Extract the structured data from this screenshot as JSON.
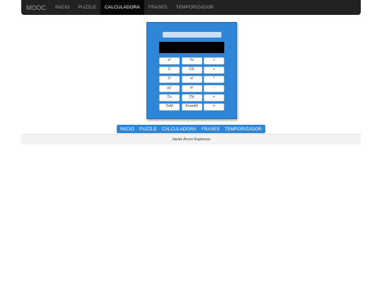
{
  "navbar": {
    "brand": "MOOC",
    "items": [
      {
        "label": "INICIO",
        "active": false
      },
      {
        "label": "PUZZLE",
        "active": false
      },
      {
        "label": "CALCULADORA",
        "active": true
      },
      {
        "label": "FRASES",
        "active": false
      },
      {
        "label": "TEMPORIZADOR",
        "active": false
      }
    ]
  },
  "calculator": {
    "display_value": "",
    "keys": [
      [
        "x²",
        "¹/x",
        "√"
      ],
      [
        "C",
        "CE",
        "+"
      ],
      [
        "2ⁿ",
        "x!",
        "*"
      ],
      [
        "μƒ",
        "xʸ",
        "-"
      ],
      [
        "Σx",
        "∏x",
        "+"
      ],
      [
        "ToM",
        "FromM",
        "="
      ]
    ]
  },
  "bottom_nav": {
    "items": [
      "INICIO",
      "PUZZLE",
      "CALCULADORA",
      "FRASES",
      "TEMPORIZADOR"
    ]
  },
  "footer": {
    "author": "Javier Arcos Espinosa"
  },
  "colors": {
    "navbar_bg": "#222222",
    "accent_blue": "#2f86d6",
    "display_bg": "#000000"
  }
}
